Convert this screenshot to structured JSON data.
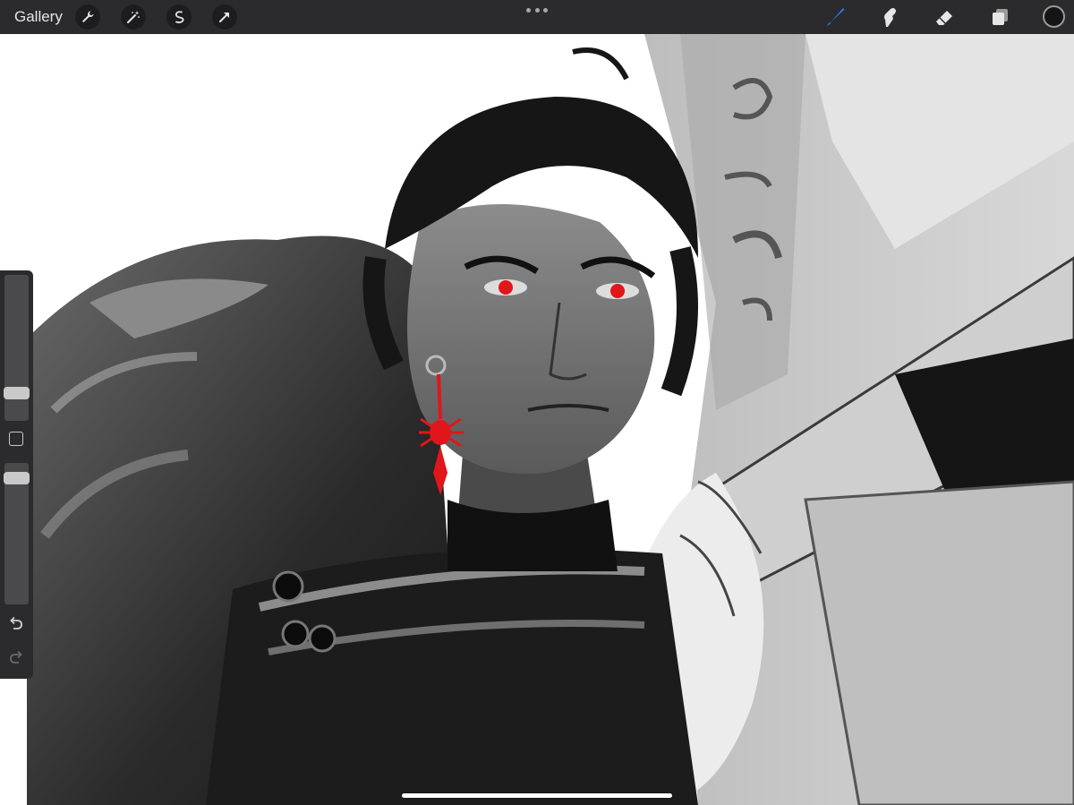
{
  "topbar": {
    "gallery_label": "Gallery",
    "left_tools": [
      "wrench-icon",
      "magic-wand-icon",
      "selection-icon",
      "transform-arrow-icon"
    ],
    "right_tools": [
      "brush-icon",
      "smudge-icon",
      "eraser-icon",
      "layers-icon"
    ],
    "active_tool": "brush-icon",
    "active_color": "#151515",
    "accent_color": "#2f7cf6"
  },
  "sidebar": {
    "brush_size_fraction": 0.28,
    "opacity_fraction": 0.9,
    "controls": [
      "brush-size-slider",
      "modify-button",
      "opacity-slider",
      "undo-icon",
      "redo-icon"
    ]
  },
  "canvas": {
    "description_icon": "artwork-canvas",
    "accent_red": "#e0161b"
  }
}
